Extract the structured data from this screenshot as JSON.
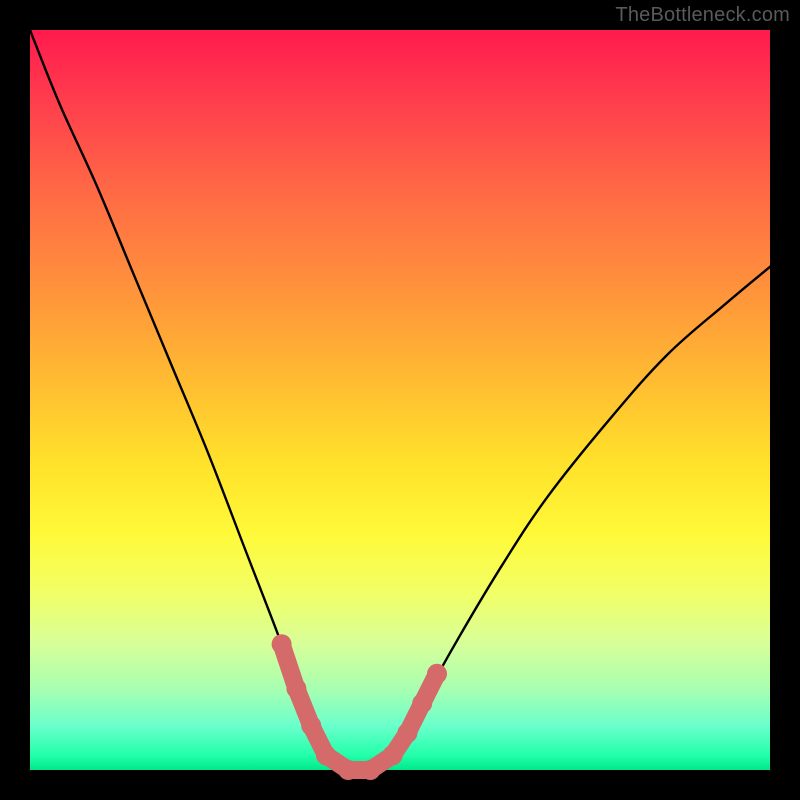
{
  "watermark": "TheBottleneck.com",
  "colors": {
    "frame": "#000000",
    "curve": "#000000",
    "marker": "#d46a6a",
    "gradient_top": "#ff1a4d",
    "gradient_bottom": "#00e88a"
  },
  "chart_data": {
    "type": "line",
    "title": "",
    "xlabel": "",
    "ylabel": "",
    "xlim": [
      0,
      100
    ],
    "ylim": [
      0,
      100
    ],
    "x_ticks": [],
    "y_ticks": [],
    "grid": false,
    "legend": false,
    "series": [
      {
        "name": "bottleneck-curve",
        "x": [
          0,
          4,
          9,
          14,
          19,
          24,
          29,
          34,
          36,
          38,
          40,
          43,
          46,
          50,
          53,
          58,
          64,
          70,
          78,
          86,
          94,
          100
        ],
        "y": [
          100,
          90,
          79,
          67,
          55,
          43,
          30,
          17,
          11,
          6,
          2,
          0,
          0,
          3,
          9,
          18,
          28,
          37,
          47,
          56,
          63,
          68
        ]
      },
      {
        "name": "optimal-marker-left",
        "x": [
          34,
          36,
          38,
          40
        ],
        "y": [
          17,
          11,
          6,
          2
        ]
      },
      {
        "name": "optimal-marker-flat",
        "x": [
          40,
          43,
          46,
          49
        ],
        "y": [
          2,
          0,
          0,
          2
        ]
      },
      {
        "name": "optimal-marker-right",
        "x": [
          49,
          51,
          53,
          55
        ],
        "y": [
          2,
          5,
          9,
          13
        ]
      }
    ],
    "annotations": []
  }
}
